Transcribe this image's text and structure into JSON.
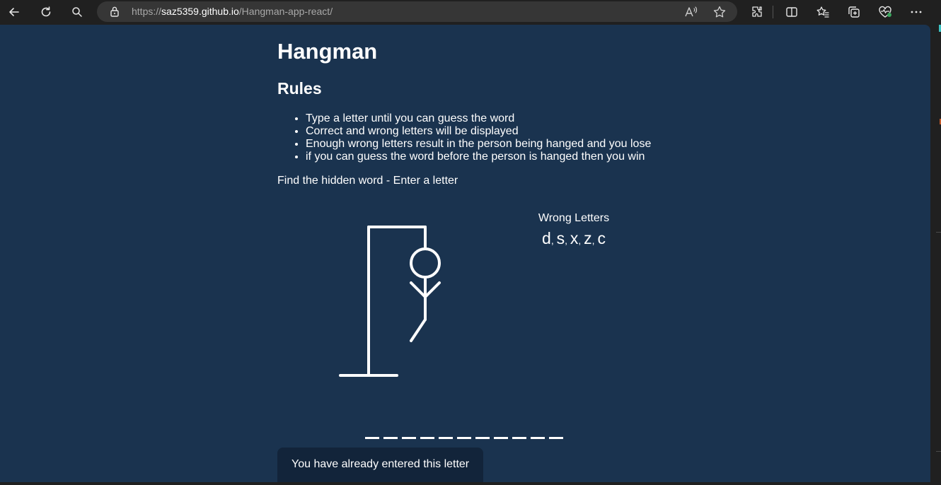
{
  "browser": {
    "url_prefix": "https://",
    "url_host": "saz5359.github.io",
    "url_path": "/Hangman-app-react/",
    "icons": [
      "back-icon",
      "refresh-icon",
      "search-icon",
      "lock-icon",
      "read-aloud-icon",
      "favorite-icon",
      "extensions-icon",
      "split-screen-icon",
      "favorites-icon",
      "collections-icon",
      "browser-essentials-icon",
      "more-icon"
    ]
  },
  "page": {
    "title": "Hangman",
    "rules_heading": "Rules",
    "rules": [
      "Type a letter until you can guess the word",
      "Correct and wrong letters will be displayed",
      "Enough wrong letters result in the person being hanged and you lose",
      "if you can guess the word before the person is hanged then you win"
    ],
    "instruction": "Find the hidden word - Enter a letter"
  },
  "game": {
    "wrong_letters_title": "Wrong Letters",
    "wrong_letters": [
      "d",
      "s",
      "x",
      "z",
      "c"
    ],
    "word_length": 11,
    "notification": "You have already entered this letter"
  },
  "colors": {
    "page_background": "#1a334f",
    "notification_background": "#12243a",
    "browser_chrome": "#202020",
    "text": "#ffffff"
  }
}
